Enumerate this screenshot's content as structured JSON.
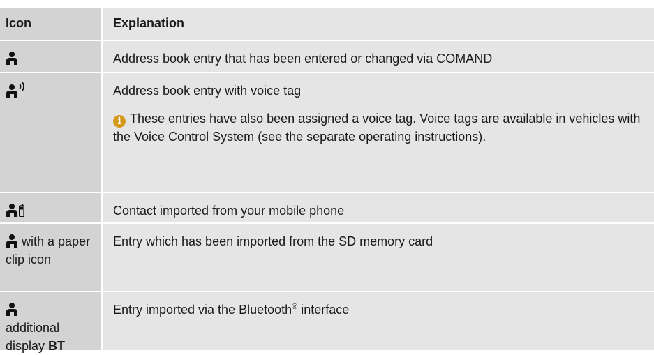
{
  "header": {
    "icon_col": "Icon",
    "explanation_col": "Explanation"
  },
  "rows": [
    {
      "icon_text": "",
      "explanation": "Address book entry that has been entered or changed via COMAND"
    },
    {
      "icon_text": "",
      "explanation": "Address book entry with voice tag",
      "note": "These entries have also been assigned a voice tag. Voice tags are available in vehicles with the Voice Control System (see the separate operating instructions)."
    },
    {
      "icon_text": "",
      "explanation": "Contact imported from your mobile phone"
    },
    {
      "icon_text": "with a paper clip icon",
      "explanation": "Entry which has been imported from the SD memory card"
    },
    {
      "icon_text_prefix": "additional display",
      "icon_text_bold": "BT",
      "explanation_prefix": "Entry imported via the Bluetooth",
      "explanation_sup": "®",
      "explanation_suffix": " interface"
    }
  ],
  "colors": {
    "header_icon_bg": "#d3d3d3",
    "cell_bg": "#e5e5e5",
    "info_icon": "#d39a1c"
  }
}
